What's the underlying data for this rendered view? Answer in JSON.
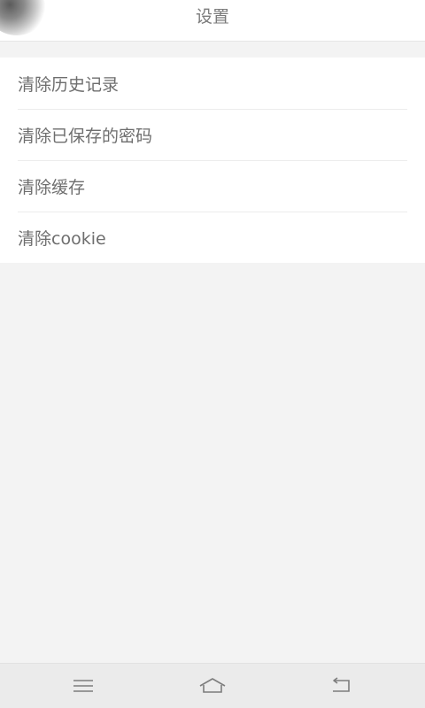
{
  "header": {
    "title": "设置",
    "back_icon": "back-blob-icon"
  },
  "settings": {
    "items": [
      {
        "label": "清除历史记录"
      },
      {
        "label": "清除已保存的密码"
      },
      {
        "label": "清除缓存"
      },
      {
        "label": "清除cookie"
      }
    ]
  },
  "navbar": {
    "icons": [
      "menu-icon",
      "home-icon",
      "back-icon"
    ]
  },
  "colors": {
    "background": "#f3f3f3",
    "text": "#6e6e6e",
    "divider": "#ececec"
  }
}
